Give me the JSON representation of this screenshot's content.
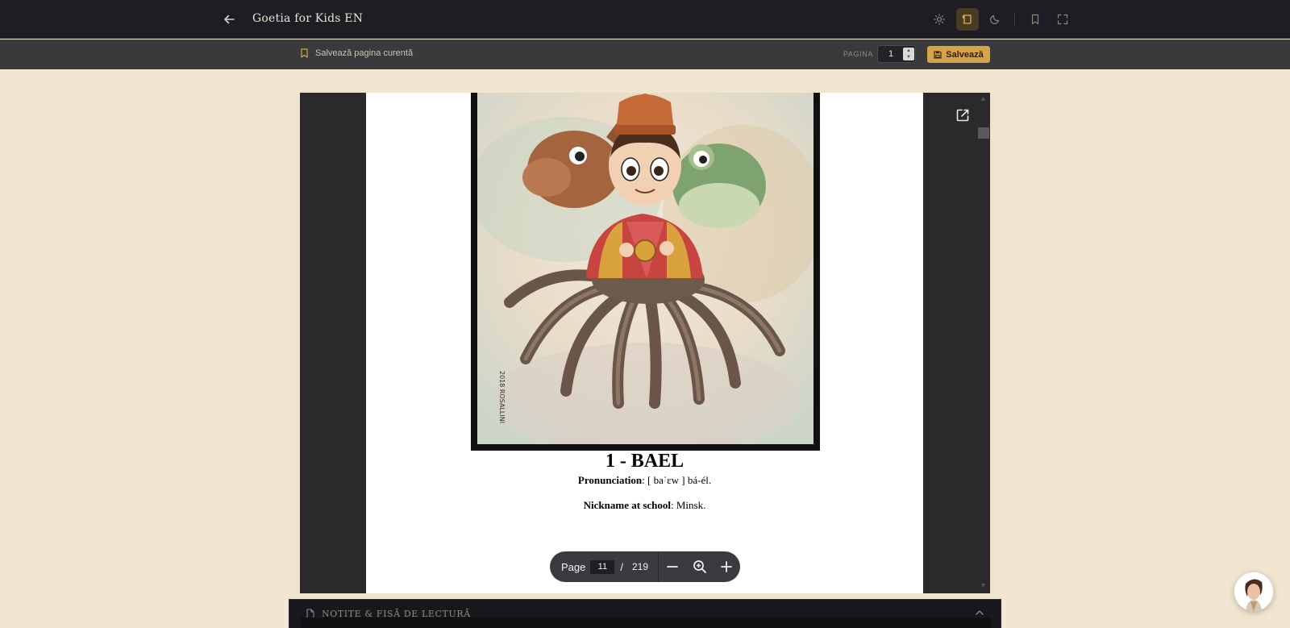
{
  "header": {
    "title": "Goetia for Kids EN",
    "icons": [
      "arrow-left-icon",
      "sun-icon",
      "scroll-icon",
      "moon-icon",
      "bookmark-icon",
      "fullscreen-icon"
    ]
  },
  "savebar": {
    "save_current_label": "Salvează pagina curentă",
    "page_label": "PAGINA",
    "page_value": "1",
    "save_button_label": "Salvează",
    "accent_color": "#d6a349"
  },
  "document": {
    "demon_title": "1 - BAEL",
    "pronunciation_label": "Pronunciation",
    "pronunciation_value": ": [ baˈɛw ] bá-él.",
    "nickname_label": "Nickname at school",
    "nickname_value": ": Minsk.",
    "signature": "2018 ROSALLINI"
  },
  "pagenav": {
    "page_label": "Page",
    "current_page": "11",
    "separator": "/",
    "total_pages": "219"
  },
  "notes": {
    "title": "NOTIȚE & FIȘĂ DE LECTURĂ"
  }
}
